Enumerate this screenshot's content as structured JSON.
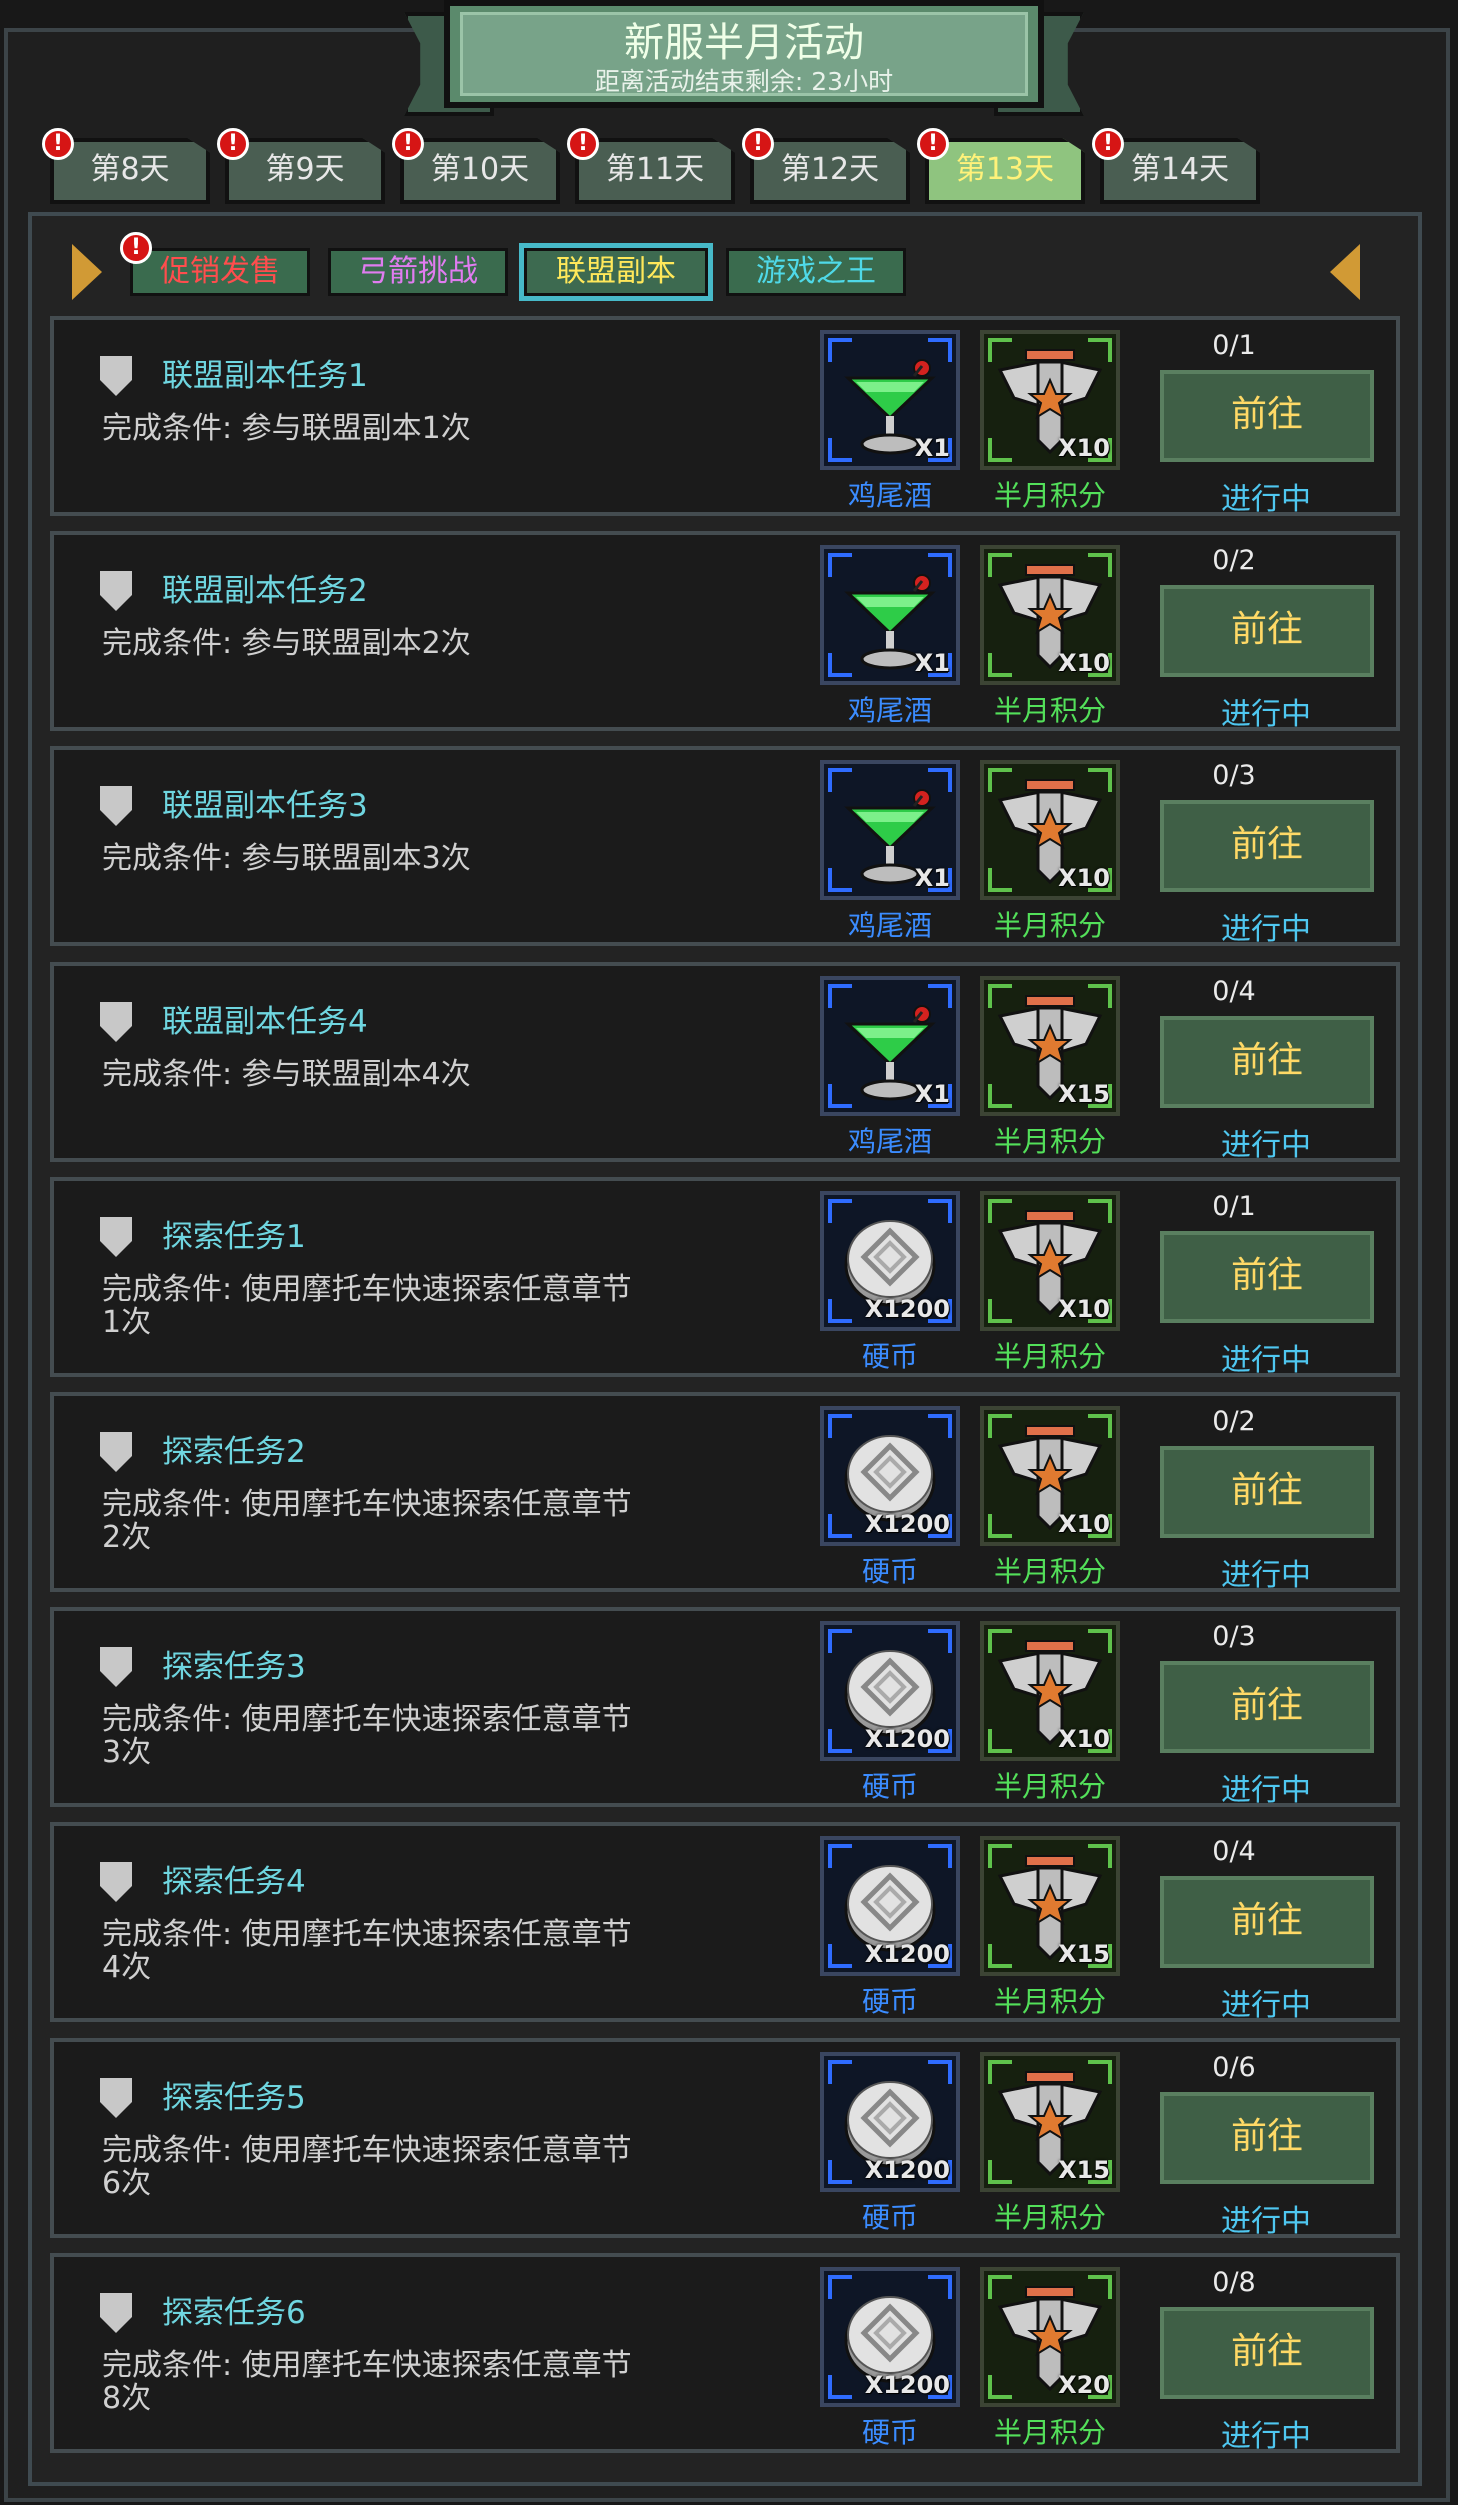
{
  "header": {
    "title": "新服半月活动",
    "subtitle": "距离活动结束剩余: 23小时"
  },
  "day_tabs": [
    {
      "label": "第8天",
      "badge": "!"
    },
    {
      "label": "第9天",
      "badge": "!"
    },
    {
      "label": "第10天",
      "badge": "!"
    },
    {
      "label": "第11天",
      "badge": "!"
    },
    {
      "label": "第12天",
      "badge": "!"
    },
    {
      "label": "第13天",
      "badge": "!",
      "active": true
    },
    {
      "label": "第14天",
      "badge": "!"
    }
  ],
  "category_tabs": [
    {
      "label": "促销发售",
      "color": "#ff4d4d",
      "badge": "!"
    },
    {
      "label": "弓箭挑战",
      "color": "#e07cf0"
    },
    {
      "label": "联盟副本",
      "color": "#ffe85a",
      "active": true
    },
    {
      "label": "游戏之王",
      "color": "#4fd9e8"
    }
  ],
  "colors": {
    "blue_label": "#3b8cff",
    "green_label": "#53e05a",
    "status": "#4fc7f0",
    "button_text": "#ffd966"
  },
  "tasks": [
    {
      "title": "联盟副本任务1",
      "condition": "完成条件: 参与联盟副本1次",
      "reward1": {
        "icon": "cocktail-icon",
        "qty": "X1",
        "label": "鸡尾酒"
      },
      "reward2": {
        "icon": "eagle-emblem-icon",
        "qty": "X10",
        "label": "半月积分"
      },
      "progress": "0/1",
      "button": "前往",
      "status": "进行中"
    },
    {
      "title": "联盟副本任务2",
      "condition": "完成条件: 参与联盟副本2次",
      "reward1": {
        "icon": "cocktail-icon",
        "qty": "X1",
        "label": "鸡尾酒"
      },
      "reward2": {
        "icon": "eagle-emblem-icon",
        "qty": "X10",
        "label": "半月积分"
      },
      "progress": "0/2",
      "button": "前往",
      "status": "进行中"
    },
    {
      "title": "联盟副本任务3",
      "condition": "完成条件: 参与联盟副本3次",
      "reward1": {
        "icon": "cocktail-icon",
        "qty": "X1",
        "label": "鸡尾酒"
      },
      "reward2": {
        "icon": "eagle-emblem-icon",
        "qty": "X10",
        "label": "半月积分"
      },
      "progress": "0/3",
      "button": "前往",
      "status": "进行中"
    },
    {
      "title": "联盟副本任务4",
      "condition": "完成条件: 参与联盟副本4次",
      "reward1": {
        "icon": "cocktail-icon",
        "qty": "X1",
        "label": "鸡尾酒"
      },
      "reward2": {
        "icon": "eagle-emblem-icon",
        "qty": "X15",
        "label": "半月积分"
      },
      "progress": "0/4",
      "button": "前往",
      "status": "进行中"
    },
    {
      "title": "探索任务1",
      "condition": "完成条件: 使用摩托车快速探索任意章节1次",
      "reward1": {
        "icon": "coin-icon",
        "qty": "X1200",
        "label": "硬币"
      },
      "reward2": {
        "icon": "eagle-emblem-icon",
        "qty": "X10",
        "label": "半月积分"
      },
      "progress": "0/1",
      "button": "前往",
      "status": "进行中"
    },
    {
      "title": "探索任务2",
      "condition": "完成条件: 使用摩托车快速探索任意章节2次",
      "reward1": {
        "icon": "coin-icon",
        "qty": "X1200",
        "label": "硬币"
      },
      "reward2": {
        "icon": "eagle-emblem-icon",
        "qty": "X10",
        "label": "半月积分"
      },
      "progress": "0/2",
      "button": "前往",
      "status": "进行中"
    },
    {
      "title": "探索任务3",
      "condition": "完成条件: 使用摩托车快速探索任意章节3次",
      "reward1": {
        "icon": "coin-icon",
        "qty": "X1200",
        "label": "硬币"
      },
      "reward2": {
        "icon": "eagle-emblem-icon",
        "qty": "X10",
        "label": "半月积分"
      },
      "progress": "0/3",
      "button": "前往",
      "status": "进行中"
    },
    {
      "title": "探索任务4",
      "condition": "完成条件: 使用摩托车快速探索任意章节4次",
      "reward1": {
        "icon": "coin-icon",
        "qty": "X1200",
        "label": "硬币"
      },
      "reward2": {
        "icon": "eagle-emblem-icon",
        "qty": "X15",
        "label": "半月积分"
      },
      "progress": "0/4",
      "button": "前往",
      "status": "进行中"
    },
    {
      "title": "探索任务5",
      "condition": "完成条件: 使用摩托车快速探索任意章节6次",
      "reward1": {
        "icon": "coin-icon",
        "qty": "X1200",
        "label": "硬币"
      },
      "reward2": {
        "icon": "eagle-emblem-icon",
        "qty": "X15",
        "label": "半月积分"
      },
      "progress": "0/6",
      "button": "前往",
      "status": "进行中"
    },
    {
      "title": "探索任务6",
      "condition": "完成条件: 使用摩托车快速探索任意章节8次",
      "reward1": {
        "icon": "coin-icon",
        "qty": "X1200",
        "label": "硬币"
      },
      "reward2": {
        "icon": "eagle-emblem-icon",
        "qty": "X20",
        "label": "半月积分"
      },
      "progress": "0/8",
      "button": "前往",
      "status": "进行中"
    }
  ]
}
